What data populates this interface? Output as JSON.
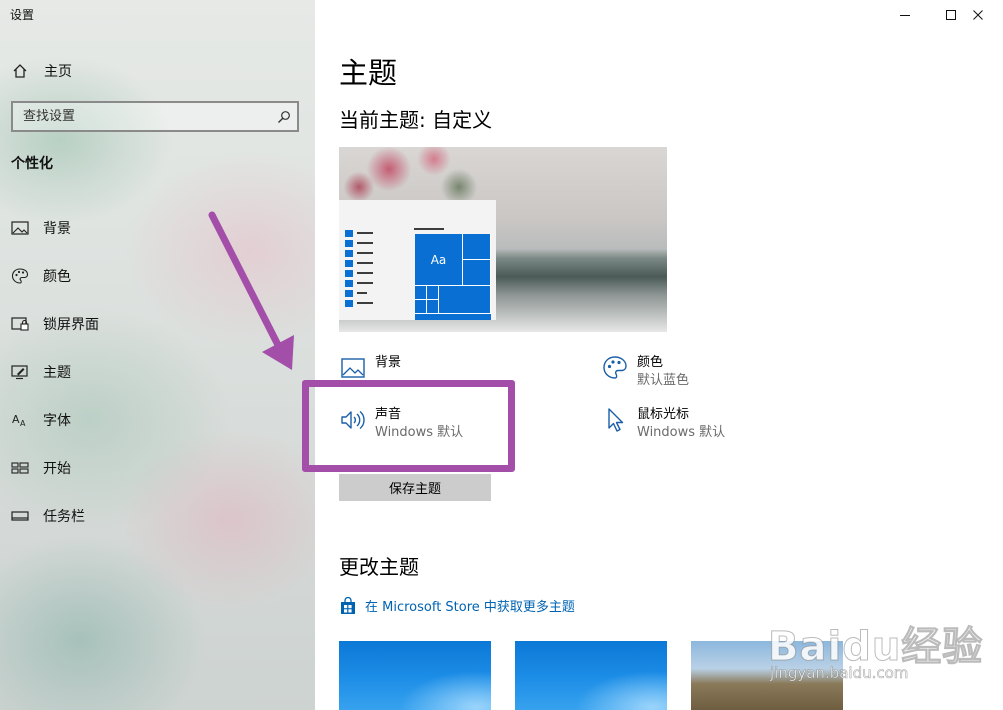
{
  "window": {
    "title": "设置"
  },
  "sidebar": {
    "home_label": "主页",
    "search_placeholder": "查找设置",
    "section_label": "个性化",
    "items": [
      {
        "label": "背景",
        "icon": "picture-icon"
      },
      {
        "label": "颜色",
        "icon": "palette-icon"
      },
      {
        "label": "锁屏界面",
        "icon": "lock-screen-icon"
      },
      {
        "label": "主题",
        "icon": "theme-icon"
      },
      {
        "label": "字体",
        "icon": "font-icon"
      },
      {
        "label": "开始",
        "icon": "start-icon"
      },
      {
        "label": "任务栏",
        "icon": "taskbar-icon"
      }
    ]
  },
  "main": {
    "page_title": "主题",
    "current_theme": "当前主题: 自定义",
    "preview_tile_text": "Aa",
    "properties": {
      "background": {
        "name": "背景"
      },
      "color": {
        "name": "颜色",
        "value": "默认蓝色"
      },
      "sound": {
        "name": "声音",
        "value": "Windows 默认"
      },
      "cursor": {
        "name": "鼠标光标",
        "value": "Windows 默认"
      }
    },
    "save_button": "保存主题",
    "change_title": "更改主题",
    "store_link": "在 Microsoft Store 中获取更多主题"
  },
  "watermark": {
    "main": "Baidu经验",
    "sub": "jingyan.baidu.com"
  },
  "colors": {
    "accent": "#0063b1",
    "tile_blue": "#0a6fd2",
    "annotation": "#a34ea8",
    "button": "#cccccc"
  }
}
